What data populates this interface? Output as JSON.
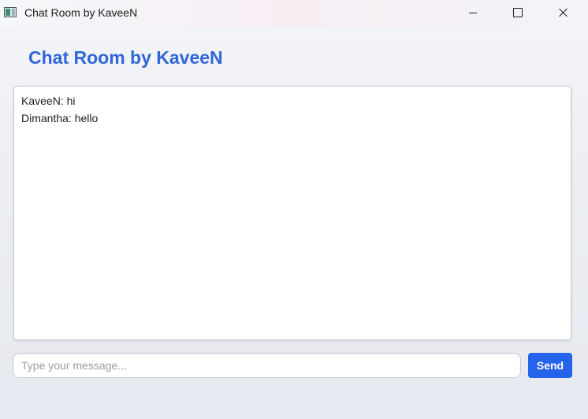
{
  "window": {
    "title": "Chat Room by KaveeN",
    "icon": "app-window-icon"
  },
  "controls": {
    "minimize_icon": "minimize-icon",
    "maximize_icon": "maximize-icon",
    "close_icon": "close-icon"
  },
  "header": {
    "title": "Chat Room by KaveeN"
  },
  "chat": {
    "messages": [
      {
        "text": "KaveeN: hi"
      },
      {
        "text": "Dimantha: hello"
      }
    ]
  },
  "composer": {
    "placeholder": "Type your message...",
    "value": "",
    "send_label": "Send"
  },
  "colors": {
    "accent": "#2563eb",
    "heading": "#2f66d9"
  }
}
